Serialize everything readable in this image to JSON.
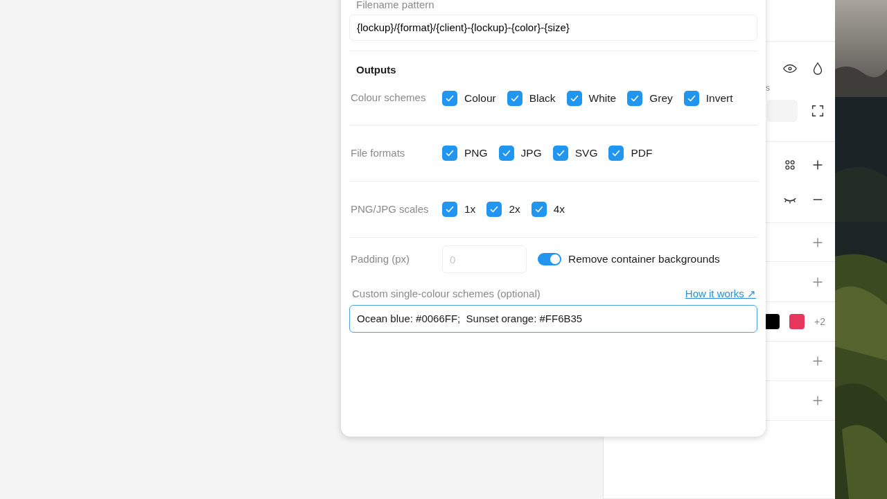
{
  "dialog": {
    "filename_pattern": {
      "label": "Filename pattern",
      "value": "{lockup}/{format}/{client}-{lockup}-{color}-{size}"
    },
    "outputs": {
      "title": "Outputs",
      "groups": [
        {
          "label": "Colour schemes",
          "options": [
            {
              "label": "Colour",
              "checked": true
            },
            {
              "label": "Black",
              "checked": true
            },
            {
              "label": "White",
              "checked": true
            },
            {
              "label": "Grey",
              "checked": true
            },
            {
              "label": "Invert",
              "checked": true
            }
          ]
        },
        {
          "label": "File formats",
          "options": [
            {
              "label": "PNG",
              "checked": true
            },
            {
              "label": "JPG",
              "checked": true
            },
            {
              "label": "SVG",
              "checked": true
            },
            {
              "label": "PDF",
              "checked": true
            }
          ]
        },
        {
          "label": "PNG/JPG scales",
          "options": [
            {
              "label": "1x",
              "checked": true
            },
            {
              "label": "2x",
              "checked": true
            },
            {
              "label": "4x",
              "checked": true
            }
          ]
        }
      ]
    },
    "padding": {
      "label": "Padding (px)",
      "placeholder": "0"
    },
    "remove_backgrounds": {
      "label": "Remove container backgrounds",
      "on": true
    },
    "custom_schemes": {
      "label": "Custom single-colour schemes (optional)",
      "link": "How it works ↗",
      "value": "Ocean blue: #0066FF;  Sunset orange: #FF6B35"
    }
  },
  "side_panel": {
    "rows": [
      {
        "kind": "blank"
      },
      {
        "kind": "view",
        "hint": "s"
      },
      {
        "kind": "layers"
      },
      {
        "kind": "add"
      },
      {
        "kind": "add"
      },
      {
        "kind": "swatches",
        "swatches": [
          {
            "color": "#000000"
          },
          {
            "color": "#e8375c"
          }
        ],
        "more": "+2"
      },
      {
        "kind": "add"
      },
      {
        "kind": "add"
      },
      {
        "kind": "blank"
      }
    ]
  }
}
